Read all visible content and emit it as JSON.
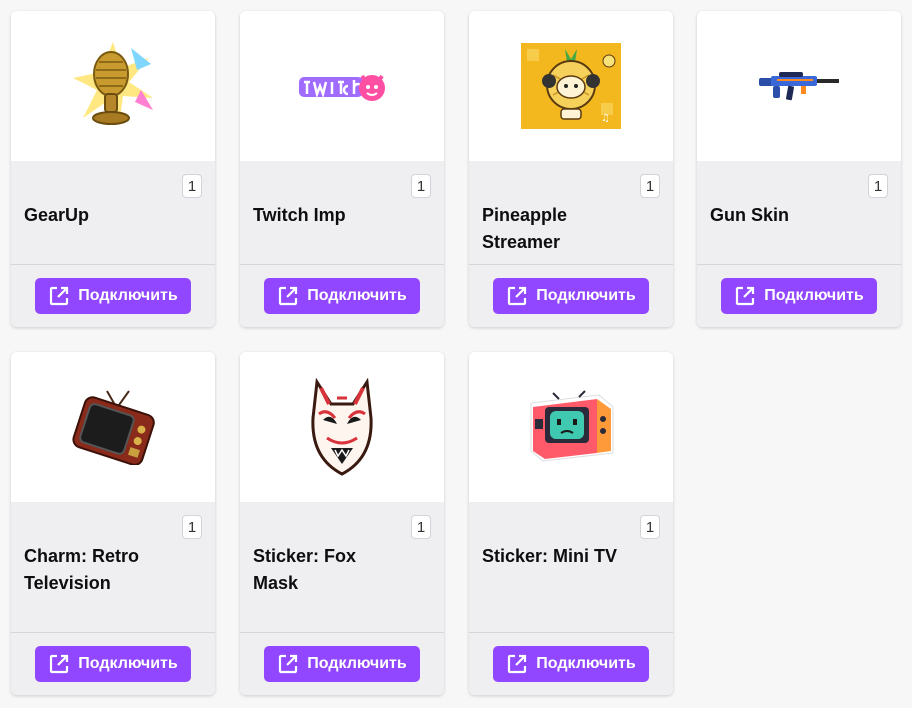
{
  "colors": {
    "accent": "#9147ff",
    "card_footer": "#efeff1",
    "page_bg": "#f7f7f8"
  },
  "button_icon": "external-link-icon",
  "items": [
    {
      "name": "GearUp",
      "count": "1",
      "button": "Подключить",
      "icon": "golden-microphone-icon"
    },
    {
      "name": "Twitch Imp",
      "count": "1",
      "button": "Подключить",
      "icon": "twitch-imp-logo-icon"
    },
    {
      "name": "Pineapple Streamer",
      "count": "1",
      "button": "Подключить",
      "icon": "pineapple-cat-icon"
    },
    {
      "name": "Gun Skin",
      "count": "1",
      "button": "Подключить",
      "icon": "rifle-icon"
    },
    {
      "name": "Charm: Retro Television",
      "count": "1",
      "button": "Подключить",
      "icon": "retro-tv-icon"
    },
    {
      "name": "Sticker: Fox Mask",
      "count": "1",
      "button": "Подключить",
      "icon": "fox-mask-icon"
    },
    {
      "name": "Sticker: Mini TV",
      "count": "1",
      "button": "Подключить",
      "icon": "mini-tv-icon"
    }
  ]
}
